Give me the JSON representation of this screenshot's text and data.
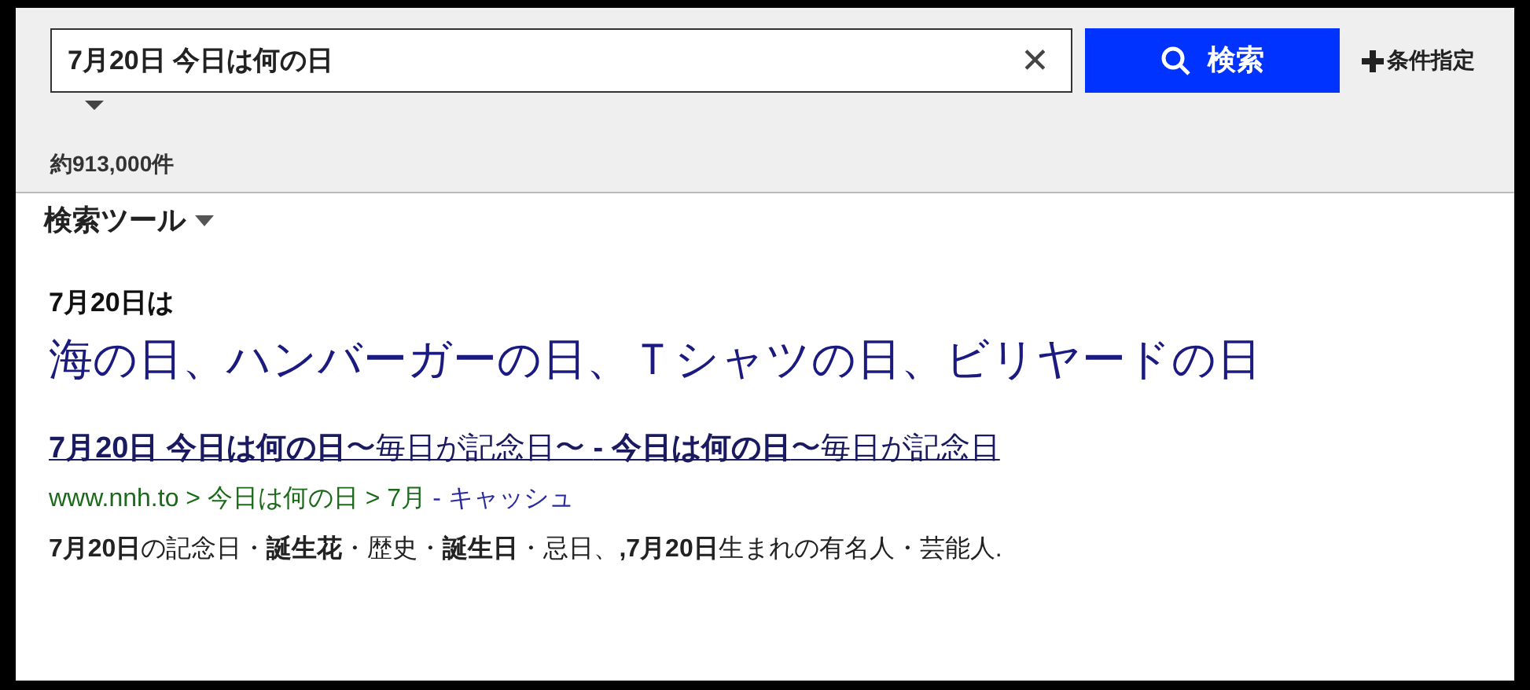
{
  "search": {
    "value": "7月20日 今日は何の日",
    "clear": "✕",
    "button": "検索",
    "advanced": "条件指定"
  },
  "result_count": "約913,000件",
  "search_tools": "検索ツール",
  "answer": {
    "heading": "7月20日は",
    "text": "海の日、ハンバーガーの日、Ｔシャツの日、ビリヤードの日"
  },
  "results": [
    {
      "title": "**7月20日 今日は何の日**〜毎日が記念日〜 **- 今日は何の日**〜毎日が記念日",
      "url": "www.nnh.to > 今日は何の日 > 7月",
      "cache": "- キャッシュ",
      "snippet": "**7月20日**の記念日・**誕生花**・歴史・**誕生日**・忌日、**,7月20日**生まれの有名人・芸能人."
    }
  ]
}
